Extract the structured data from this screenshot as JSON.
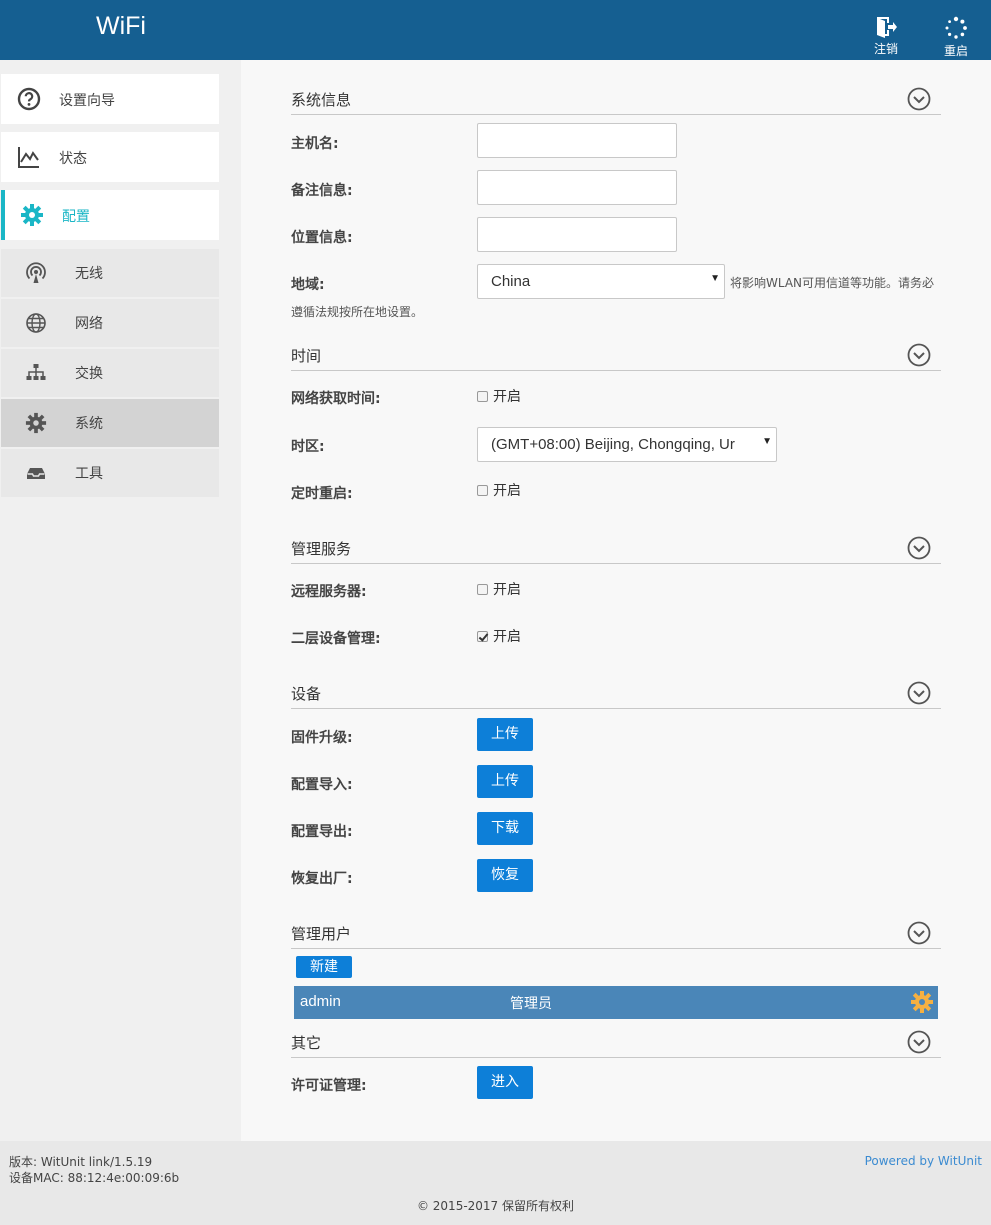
{
  "header": {
    "brand": "WiFi",
    "logout_label": "注销",
    "reboot_label": "重启"
  },
  "sidebar": {
    "items": [
      {
        "label": "设置向导",
        "icon": "question-circle-icon"
      },
      {
        "label": "状态",
        "icon": "line-chart-icon"
      },
      {
        "label": "配置",
        "icon": "gear-icon",
        "active": true
      }
    ],
    "subitems": [
      {
        "label": "无线",
        "icon": "wireless-antenna-icon"
      },
      {
        "label": "网络",
        "icon": "globe-icon"
      },
      {
        "label": "交换",
        "icon": "sitemap-icon"
      },
      {
        "label": "系统",
        "icon": "gear-icon",
        "selected": true
      },
      {
        "label": "工具",
        "icon": "inbox-tray-icon"
      }
    ],
    "active_color": "#1ab6c6"
  },
  "sections": {
    "system_info": {
      "title": "系统信息",
      "hostname_label": "主机名:",
      "hostname_value": "",
      "note_label": "备注信息:",
      "note_value": "",
      "location_label": "位置信息:",
      "location_value": "",
      "region_label": "地域:",
      "region_value": "China",
      "region_hint_line1": "将影响WLAN可用信道等功能。请务必",
      "region_hint_line2": "遵循法规按所在地设置。"
    },
    "time": {
      "title": "时间",
      "ntp_label": "网络获取时间:",
      "ntp_option": "开启",
      "ntp_checked": false,
      "timezone_label": "时区:",
      "timezone_value": "(GMT+08:00) Beijing, Chongqing, Ur",
      "scheduled_reboot_label": "定时重启:",
      "scheduled_reboot_option": "开启",
      "scheduled_reboot_checked": false
    },
    "management": {
      "title": "管理服务",
      "remote_server_label": "远程服务器:",
      "remote_server_option": "开启",
      "remote_server_checked": false,
      "l2_mgmt_label": "二层设备管理:",
      "l2_mgmt_option": "开启",
      "l2_mgmt_checked": true
    },
    "device": {
      "title": "设备",
      "firmware_label": "固件升级:",
      "firmware_button": "上传",
      "config_import_label": "配置导入:",
      "config_import_button": "上传",
      "config_export_label": "配置导出:",
      "config_export_button": "下载",
      "factory_reset_label": "恢复出厂:",
      "factory_reset_button": "恢复"
    },
    "users": {
      "title": "管理用户",
      "new_button": "新建",
      "rows": [
        {
          "name": "admin",
          "role": "管理员"
        }
      ]
    },
    "other": {
      "title": "其它",
      "license_label": "许可证管理:",
      "license_button": "进入"
    }
  },
  "footer": {
    "version": "版本: WitUnit link/1.5.19",
    "mac": "设备MAC: 88:12:4e:00:09:6b",
    "powered": "Powered by WitUnit",
    "copyright": "© 2015-2017  保留所有权利"
  },
  "colors": {
    "header_bg": "#155f91",
    "button_bg": "#0d7fd8",
    "user_row_bg": "#4a86b8",
    "gear_accent": "#f5b041"
  }
}
